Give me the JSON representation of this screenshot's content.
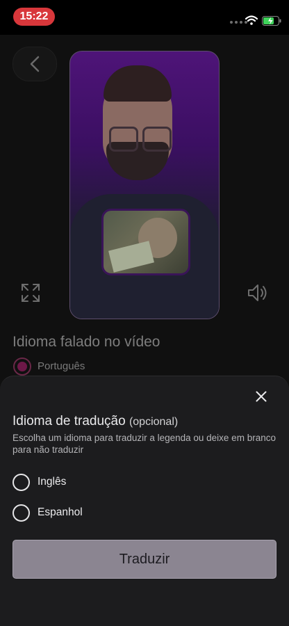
{
  "status_bar": {
    "time": "15:22"
  },
  "colors": {
    "time_pill": "#d8373b",
    "radio_selected": "#6e1848",
    "sheet_background": "#1c1c1e",
    "translate_button": "#8b8591"
  },
  "icons": {
    "back": "chevron-left-icon",
    "fullscreen": "expand-icon",
    "volume": "speaker-icon",
    "close": "close-icon",
    "wifi": "wifi-icon",
    "battery": "battery-charging-icon"
  },
  "spoken_language": {
    "title": "Idioma falado no vídeo",
    "selected": "Português"
  },
  "translation_sheet": {
    "title": "Idioma de tradução",
    "title_suffix": "(opcional)",
    "subtitle": "Escolha um idioma para traduzir a legenda ou deixe em branco para não traduzir",
    "options": [
      {
        "label": "Inglês",
        "selected": false
      },
      {
        "label": "Espanhol",
        "selected": false
      }
    ],
    "submit_label": "Traduzir"
  }
}
